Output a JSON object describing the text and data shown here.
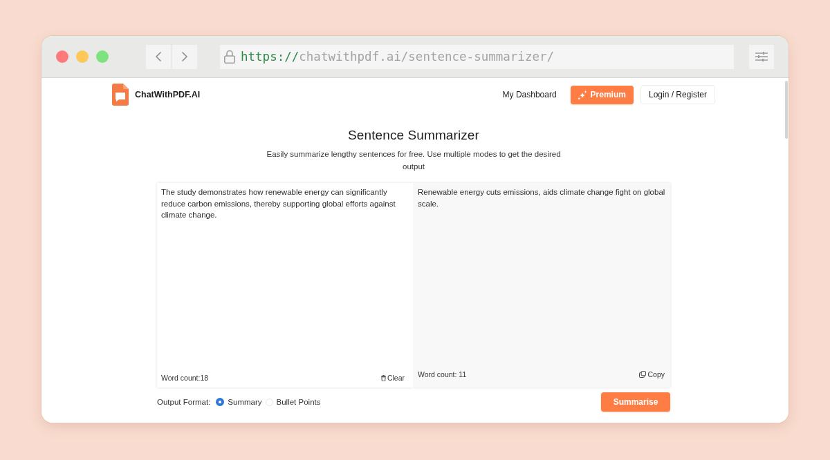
{
  "browser": {
    "url_scheme": "https://",
    "url_rest": "chatwithpdf.ai/sentence-summarizer/"
  },
  "header": {
    "brand": "ChatWithPDF.AI",
    "nav": [
      {
        "label": "My Dashboard",
        "kind": "link"
      },
      {
        "label": "Premium",
        "kind": "primary"
      },
      {
        "label": "Login / Register",
        "kind": "outline"
      }
    ]
  },
  "title": "Sentence Summarizer",
  "subtitle": "Easily summarize lengthy sentences for free. Use multiple modes to get the desired output",
  "input": {
    "value": "The study demonstrates how renewable energy can significantly reduce carbon emissions, thereby supporting global efforts against climate change.",
    "word_count": "Word count:18",
    "action": "Clear"
  },
  "output": {
    "text": "Renewable energy cuts emissions, aids climate change fight on global scale.",
    "word_count": "Word count: 11",
    "action": "Copy"
  },
  "output_format": {
    "label": "Output Format:",
    "options": [
      {
        "label": "Summary",
        "selected": true
      },
      {
        "label": "Bullet Points",
        "selected": false
      }
    ]
  },
  "submit": "Summarise"
}
